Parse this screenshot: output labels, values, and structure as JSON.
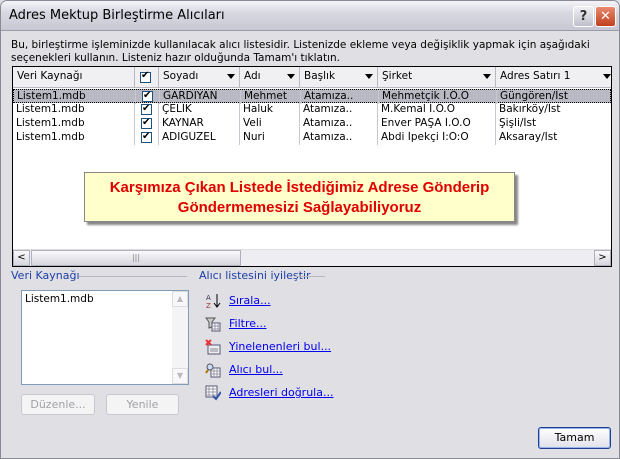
{
  "window": {
    "title": "Adres Mektup Birleştirme Alıcıları",
    "help": "?",
    "close": "✕"
  },
  "description": "Bu, birleştirme işleminizde kullanılacak alıcı listesidir. Listenizde ekleme veya değişiklik yapmak için aşağıdaki seçenekleri kullanın. Listeniz hazır olduğunda Tamam'ı tıklatın.",
  "table": {
    "columns": [
      "Veri Kaynağı",
      "",
      "Soyadı",
      "Adı",
      "Başlık",
      "Şirket",
      "Adres Satırı 1"
    ],
    "rows": [
      {
        "source": "Listem1.mdb",
        "checked": true,
        "soyadi": "GARDIYAN",
        "adi": "Mehmet",
        "baslik": "Atamıza..",
        "sirket": "Mehmetçik İ.Ö.O",
        "adres": "Güngören/İst"
      },
      {
        "source": "Listem1.mdb",
        "checked": true,
        "soyadi": "ÇELİK",
        "adi": "Haluk",
        "baslik": "Atamıza..",
        "sirket": "M.Kemal İ.Ö.O",
        "adres": "Bakırköy/İst"
      },
      {
        "source": "Listem1.mdb",
        "checked": true,
        "soyadi": "KAYNAR",
        "adi": "Veli",
        "baslik": "Atamıza..",
        "sirket": "Enver PAŞA İ.Ö.O",
        "adres": "Şişli/İst"
      },
      {
        "source": "Listem1.mdb",
        "checked": true,
        "soyadi": "ADIGÜZEL",
        "adi": "Nuri",
        "baslik": "Atamıza..",
        "sirket": "Abdi İpekçi İ:Ö:O",
        "adres": "Aksaray/İst"
      }
    ]
  },
  "annotation": {
    "line1": "Karşımıza Çıkan Listede İstediğimiz Adrese Gönderip",
    "line2": "Göndermemesizi Sağlayabiliyoruz"
  },
  "source_group": {
    "label": "Veri Kaynağı",
    "items": [
      "Listem1.mdb"
    ],
    "edit": "Düzenle...",
    "refresh": "Yenile"
  },
  "refine_group": {
    "label": "Alıcı listesini iyileştir",
    "links": [
      {
        "icon": "sort-az-icon",
        "label": "Sırala..."
      },
      {
        "icon": "filter-icon",
        "label": "Filtre..."
      },
      {
        "icon": "find-duplicates-icon",
        "label": "Yinelenenleri bul..."
      },
      {
        "icon": "find-recipient-icon",
        "label": "Alıcı bul..."
      },
      {
        "icon": "validate-addresses-icon",
        "label": "Adresleri doğrula..."
      }
    ]
  },
  "ok": "Tamam"
}
